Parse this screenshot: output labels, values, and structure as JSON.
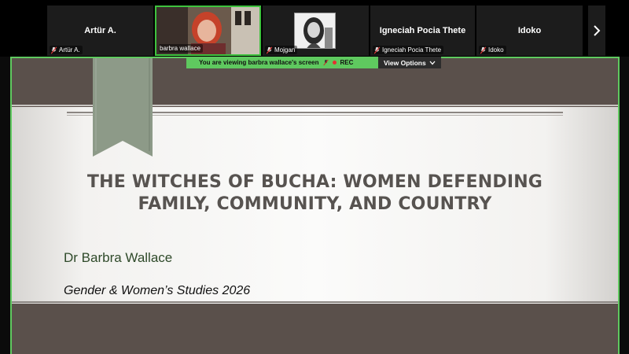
{
  "participants": [
    {
      "name": "Artür A.",
      "tag": "Artür A.",
      "muted": true
    },
    {
      "name": "",
      "tag": "barbra wallace",
      "muted": false,
      "active_speaker": true
    },
    {
      "name": "",
      "tag": "Mojgan",
      "muted": true
    },
    {
      "name": "Igneciah Pocia Thete",
      "tag": "Igneciah Pocia Thete",
      "muted": true
    },
    {
      "name": "Idoko",
      "tag": "Idoko",
      "muted": true
    }
  ],
  "banner": {
    "message": "You are viewing  barbra wallace's screen",
    "rec": "REC",
    "view_options": "View Options"
  },
  "slide": {
    "title_line1": "THE WITCHES OF BUCHA: WOMEN DEFENDING",
    "title_line2": "FAMILY, COMMUNITY, AND COUNTRY",
    "author": "Dr Barbra Wallace",
    "course": "Gender & Women’s Studies 2026"
  },
  "colors": {
    "active_speaker_border": "#3ec33e",
    "banner_bg": "#5fc95f",
    "slide_band": "#5a504b",
    "ribbon": "#8d9a88"
  },
  "icons": {
    "muted": "microphone-off-icon",
    "next": "chevron-right-icon",
    "options": "chevron-down-icon"
  }
}
